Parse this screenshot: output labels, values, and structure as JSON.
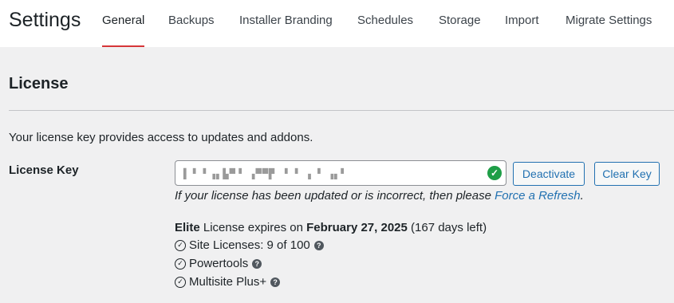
{
  "header": {
    "title": "Settings",
    "tabs": [
      {
        "label": "General",
        "active": true
      },
      {
        "label": "Backups",
        "active": false
      },
      {
        "label": "Installer Branding",
        "active": false
      },
      {
        "label": "Schedules",
        "active": false
      },
      {
        "label": "Storage",
        "active": false
      },
      {
        "label": "Import",
        "active": false
      },
      {
        "label": "Migrate Settings",
        "active": false
      }
    ]
  },
  "license": {
    "section_title": "License",
    "intro": "Your license key provides access to updates and addons.",
    "field_label": "License Key",
    "key_value": "▌▝ ▘▗▖▙▀▝ ▗▀▀▛ ▝  ▘ ▖▝ ▗▖▘",
    "valid_icon": "check-circle-icon",
    "deactivate_label": "Deactivate",
    "clear_label": "Clear Key",
    "help_text": "If your license has been updated or is incorrect, then please ",
    "help_link": "Force a Refresh",
    "help_end": ".",
    "expiry": {
      "tier": "Elite",
      "text": " License expires on ",
      "date": "February 27, 2025",
      "remaining": " (167 days left)"
    },
    "features": [
      {
        "label": "Site Licenses: 9 of 100",
        "help": true
      },
      {
        "label": "Powertools",
        "help": true
      },
      {
        "label": "Multisite Plus+",
        "help": true
      }
    ]
  },
  "colors": {
    "accent": "#2271b1",
    "active_tab": "#d63638",
    "valid": "#1e9e47"
  }
}
